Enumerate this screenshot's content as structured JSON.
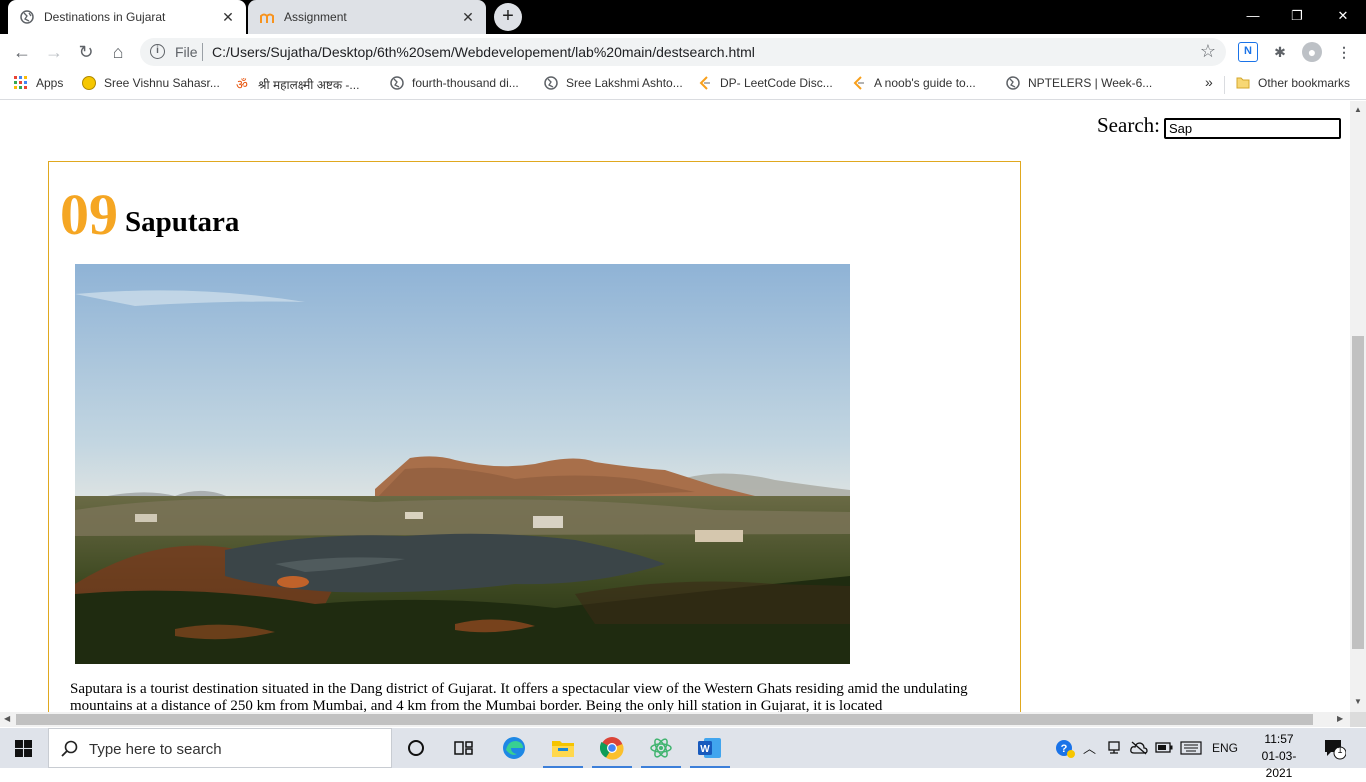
{
  "browser": {
    "tabs": [
      {
        "title": "Destinations in Gujarat",
        "active": true
      },
      {
        "title": "Assignment",
        "active": false
      }
    ],
    "new_tab_symbol": "+",
    "window_controls": {
      "minimize": "—",
      "restore": "❐",
      "close": "✕"
    },
    "address_bar": {
      "info_symbol": "i",
      "scheme_label": "File",
      "url": "C:/Users/Sujatha/Desktop/6th%20sem/Webdevelopement/lab%20main/destsearch.html"
    },
    "bookmarks": [
      {
        "label": "Apps",
        "icon": "apps-grid-icon"
      },
      {
        "label": "Sree Vishnu Sahasr...",
        "icon": "smiley-icon"
      },
      {
        "label": "श्री महालक्ष्मी अष्टक -...",
        "icon": "om-icon"
      },
      {
        "label": "fourth-thousand di...",
        "icon": "globe-icon"
      },
      {
        "label": "Sree Lakshmi Ashto...",
        "icon": "globe-icon"
      },
      {
        "label": "DP- LeetCode Disc...",
        "icon": "leetcode-icon"
      },
      {
        "label": "A noob's guide to...",
        "icon": "leetcode-icon"
      },
      {
        "label": "NPTELERS | Week-6...",
        "icon": "globe-icon"
      }
    ],
    "bookmarks_overflow": "»",
    "other_bookmarks": "Other bookmarks"
  },
  "page": {
    "search_label": "Search:",
    "search_value": "Sap",
    "destination": {
      "number": "09",
      "title": "Saputara",
      "description": "Saputara is a tourist destination situated in the Dang district of Gujarat. It offers a spectacular view of the Western Ghats residing amid the undulating mountains at a distance of 250 km from Mumbai, and 4 km from the Mumbai border. Being the only hill station in Gujarat, it is located"
    }
  },
  "taskbar": {
    "search_placeholder": "Type here to search",
    "language": "ENG",
    "time": "11:57",
    "date": "01-03-2021",
    "notification_count": "1"
  },
  "colors": {
    "accent_number": "#f5a623",
    "card_border": "#e0a81f",
    "tab_strip": "#000000"
  }
}
